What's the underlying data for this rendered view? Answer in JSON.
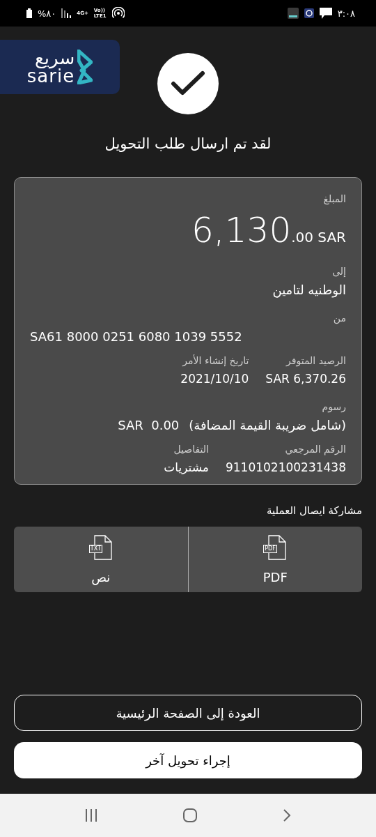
{
  "status_bar": {
    "time": "٣:٠٨",
    "battery": "%٨٠",
    "network": "4G+",
    "volte": "Vo))",
    "lte": "LTE1"
  },
  "logo": {
    "arabic": "سريع",
    "latin": "sarie"
  },
  "title": "لقد تم ارسال طلب التحويل",
  "details": {
    "amount_label": "المبلغ",
    "amount_main": "6,130",
    "amount_fraction": ".00 SAR",
    "to_label": "إلى",
    "to_value": "الوطنيه لتامين",
    "from_label": "من",
    "from_value": "SA61 8000 0251 6080 1039 5552",
    "pairs": [
      {
        "label": "الرصيد المتوفر",
        "value": "SAR 6,370.26"
      },
      {
        "label": "تاريخ إنشاء الأمر",
        "value": "2021/10/10"
      }
    ],
    "fee_label": "رسوم",
    "fee_note": "(شامل ضريبة القيمة المضافة)",
    "fee_amount": "SAR  0.00",
    "pairs2": [
      {
        "label": "الرقم المرجعي",
        "value": "9110102100231438"
      },
      {
        "label": "التفاصيل",
        "value": "مشتريات"
      }
    ]
  },
  "share": {
    "label": "مشاركة ايصال العملية",
    "options": [
      {
        "icon_text": "PDF",
        "label": "PDF"
      },
      {
        "icon_text": "TXT",
        "label": "نص"
      }
    ]
  },
  "buttons": [
    {
      "label": "العودة إلى الصفحة الرئيسية",
      "kind": "outline"
    },
    {
      "label": "إجراء تحويل آخر",
      "kind": "filled"
    }
  ]
}
